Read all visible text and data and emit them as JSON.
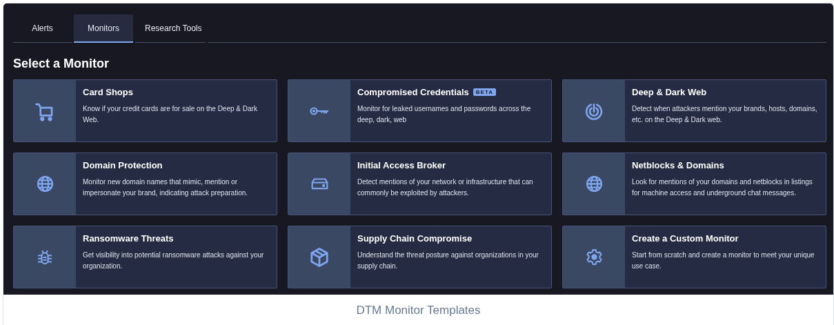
{
  "tabs": [
    {
      "label": "Alerts",
      "selected": false
    },
    {
      "label": "Monitors",
      "selected": true
    },
    {
      "label": "Research Tools",
      "selected": false
    }
  ],
  "heading": "Select a Monitor",
  "cards": [
    {
      "title": "Card Shops",
      "description": "Know if your credit cards are for sale on the Deep & Dark Web."
    },
    {
      "title": "Compromised Credentials",
      "badge": "BETA",
      "description": "Monitor for leaked usernames and passwords across the deep, dark, web"
    },
    {
      "title": "Deep & Dark Web",
      "description": "Detect when attackers mention your brands, hosts, domains, etc. on the Deep & Dark web."
    },
    {
      "title": "Domain Protection",
      "description": "Monitor new domain names that mimic, mention or impersonate your brand, indicating attack preparation."
    },
    {
      "title": "Initial Access Broker",
      "description": "Detect mentions of your network or infrastructure that can commonly be exploited by attackers."
    },
    {
      "title": "Netblocks & Domains",
      "description": "Look for mentions of your domains and netblocks in listings for machine access and underground chat messages."
    },
    {
      "title": "Ransomware Threats",
      "description": "Get visibility into potential ransomware attacks against your organization."
    },
    {
      "title": "Supply Chain Compromise",
      "description": "Understand the threat posture against organizations in your supply chain."
    },
    {
      "title": "Create a Custom Monitor",
      "description": "Start from scratch and create a monitor to meet your unique use case."
    }
  ],
  "caption": "DTM Monitor Templates"
}
